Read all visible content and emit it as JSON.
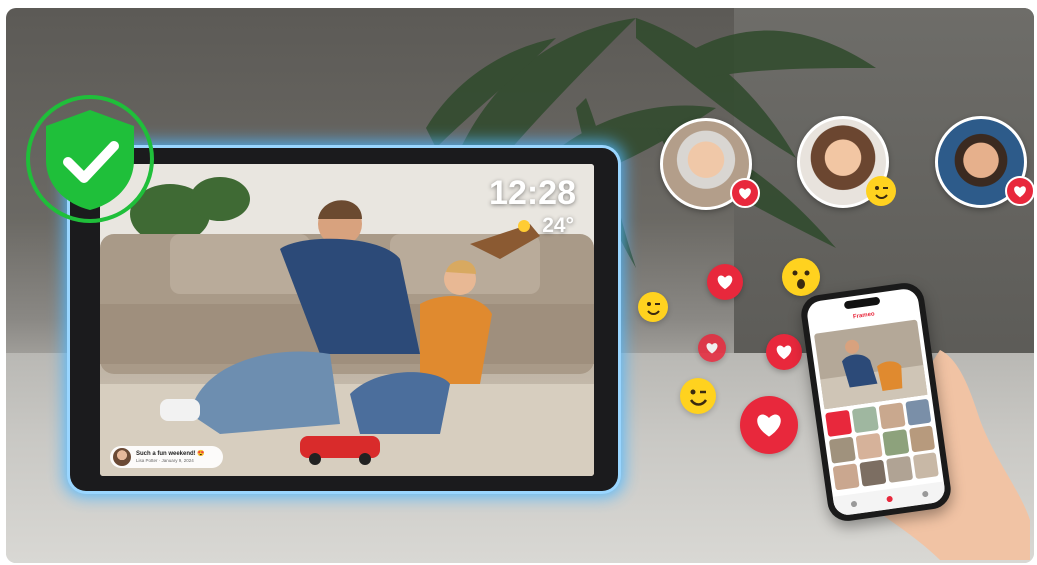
{
  "frame_screen": {
    "time": "12:28",
    "weather": {
      "icon": "sun-cloud-icon",
      "temperature": "24°"
    },
    "caption": {
      "message": "Such a fun weekend! 😍",
      "meta": "Lisa Potter · January 9, 2024"
    }
  },
  "badges": {
    "verified": {
      "icon": "shield-check-icon",
      "color": "#1fbf3a"
    }
  },
  "reactions": {
    "avatars": [
      {
        "name": "avatar-elderly-woman",
        "reaction": "heart-icon"
      },
      {
        "name": "avatar-young-woman",
        "reaction": "wink-emoji-icon"
      },
      {
        "name": "avatar-man-glasses",
        "reaction": "heart-icon"
      }
    ]
  },
  "phone": {
    "app_name": "Frameo"
  },
  "colors": {
    "accent_blue_glow": "#4fb8ff",
    "heart_red": "#e8283c",
    "emoji_yellow": "#ffd21f",
    "check_green": "#1fbf3a"
  }
}
